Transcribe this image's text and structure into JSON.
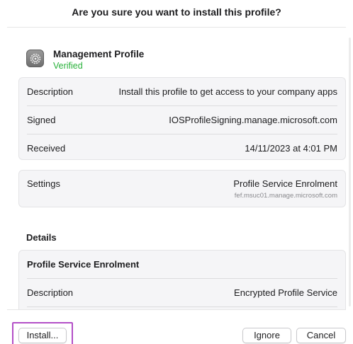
{
  "dialog": {
    "title": "Are you sure you want to install this profile?"
  },
  "profile": {
    "name": "Management Profile",
    "status": "Verified",
    "icon": "settings-gear-icon",
    "status_color": "#28b13a"
  },
  "info_rows": [
    {
      "label": "Description",
      "value": "Install this profile to get access to your company apps"
    },
    {
      "label": "Signed",
      "value": "IOSProfileSigning.manage.microsoft.com"
    },
    {
      "label": "Received",
      "value": "14/11/2023 at 4:01 PM"
    }
  ],
  "settings": {
    "label": "Settings",
    "value": "Profile Service Enrolment",
    "subvalue": "fef.msuc01.manage.microsoft.com"
  },
  "details": {
    "heading": "Details",
    "subheading": "Profile Service Enrolment",
    "rows": [
      {
        "label": "Description",
        "value": "Encrypted Profile Service"
      }
    ]
  },
  "buttons": {
    "install": "Install...",
    "ignore": "Ignore",
    "cancel": "Cancel"
  },
  "highlight_color": "#b34fc7"
}
